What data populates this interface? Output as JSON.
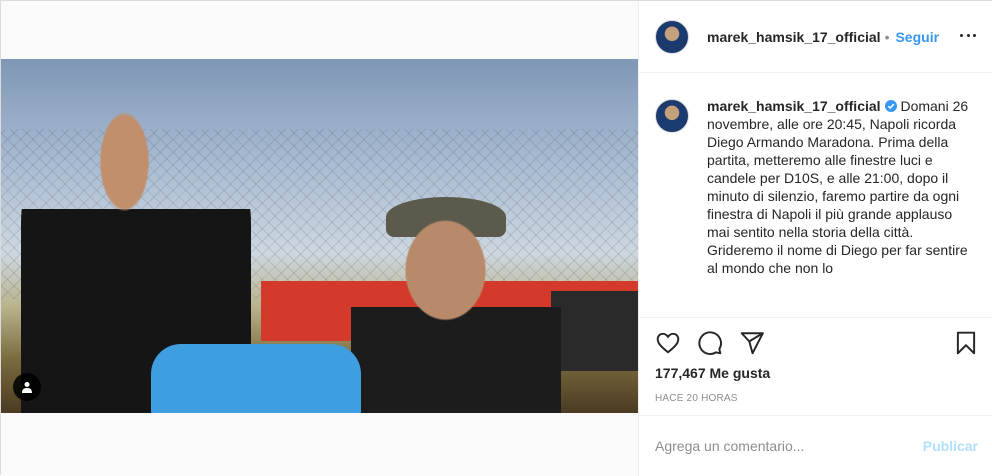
{
  "post": {
    "username": "marek_hamsik_17_official",
    "follow_label": "Seguir",
    "separator": "•",
    "caption_username": "marek_hamsik_17_official",
    "caption_text": "Domani 26 novembre, alle ore 20:45, Napoli ricorda Diego Armando Maradona. Prima della partita, metteremo alle finestre luci e candele per D10S, e alle 21:00, dopo il minuto di silenzio, faremo partire da ogni finestra di Napoli il più grande applauso mai sentito nella storia della città. Grideremo il nome di Diego per far sentire al mondo che non lo",
    "likes_count": "177,467",
    "likes_label": "Me gusta",
    "timestamp": "HACE 20 HORAS",
    "comment_placeholder": "Agrega un comentario...",
    "publish_label": "Publicar"
  },
  "icons": {
    "like": "heart-icon",
    "comment": "comment-icon",
    "share": "share-icon",
    "save": "bookmark-icon",
    "more": "more-options-icon",
    "verified": "verified-badge-icon",
    "tag": "user-tag-icon"
  },
  "colors": {
    "link_blue": "#3897f0",
    "publish_disabled": "#b2dffc",
    "muted": "#8e8e8e",
    "text": "#262626",
    "border": "#efefef"
  }
}
